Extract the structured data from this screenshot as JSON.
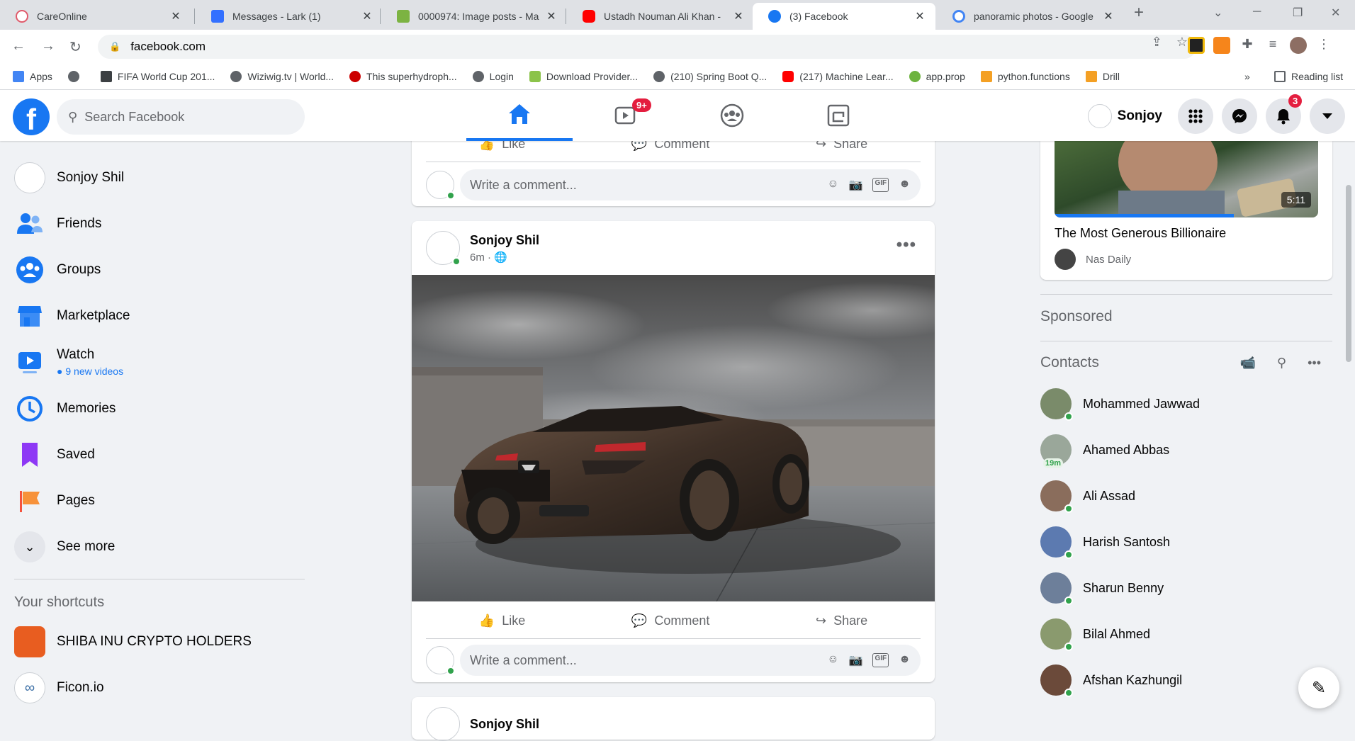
{
  "browser": {
    "tabs": [
      {
        "title": "CareOnline",
        "color": "#e05a6b"
      },
      {
        "title": "Messages - Lark (1)",
        "color": "#3370ff"
      },
      {
        "title": "0000974: Image posts - Ma",
        "color": "#7cb342"
      },
      {
        "title": "Ustadh Nouman Ali Khan -",
        "color": "#ff0000"
      },
      {
        "title": "(3) Facebook",
        "color": "#1877f2"
      },
      {
        "title": "panoramic photos - Google",
        "color": "#4285f4"
      }
    ],
    "new_tab": "+",
    "url": "facebook.com",
    "bookmarks": [
      {
        "label": "Apps",
        "color": "#4285f4"
      },
      {
        "label": "",
        "color": "#5f6368"
      },
      {
        "label": "FIFA World Cup 201...",
        "color": "#3c4043"
      },
      {
        "label": "Wiziwig.tv | World...",
        "color": "#5f6368"
      },
      {
        "label": "This superhydroph...",
        "color": "#cc0000"
      },
      {
        "label": "Login",
        "color": "#5f6368"
      },
      {
        "label": "Download Provider...",
        "color": "#8bc34a"
      },
      {
        "label": "(210) Spring Boot Q...",
        "color": "#5f6368"
      },
      {
        "label": "(217) Machine Lear...",
        "color": "#ff0000"
      },
      {
        "label": "app.prop",
        "color": "#6db33f"
      },
      {
        "label": "python.functions",
        "color": "#f4a024"
      },
      {
        "label": "Drill",
        "color": "#f4a024"
      }
    ],
    "bookmarks_more": "»",
    "reading_list": "Reading list"
  },
  "header": {
    "logo": "f",
    "search_placeholder": "Search Facebook",
    "watch_badge": "9+",
    "profile_name": "Sonjoy",
    "notifications_badge": "3"
  },
  "left_nav": {
    "profile": "Sonjoy Shil",
    "items": [
      {
        "label": "Friends",
        "color": "#1877f2"
      },
      {
        "label": "Groups",
        "color": "#1877f2"
      },
      {
        "label": "Marketplace",
        "color": "#1877f2"
      },
      {
        "label": "Watch",
        "sub": "9 new videos",
        "color": "#1877f2"
      },
      {
        "label": "Memories",
        "color": "#1877f2"
      },
      {
        "label": "Saved",
        "color": "#8e38f5"
      },
      {
        "label": "Pages",
        "color": "#f5533d"
      }
    ],
    "see_more": "See more",
    "shortcuts_title": "Your shortcuts",
    "shortcuts": [
      {
        "label": "SHIBA INU CRYPTO HOLDERS",
        "color": "#e85d20"
      },
      {
        "label": "Ficon.io",
        "color": "#3a6ea5"
      }
    ]
  },
  "feed": {
    "actions": {
      "like": "Like",
      "comment": "Comment",
      "share": "Share"
    },
    "comment_placeholder": "Write a comment...",
    "post": {
      "author": "Sonjoy Shil",
      "time": "6m ·"
    },
    "next_post_author": "Sonjoy Shil"
  },
  "right_col": {
    "video": {
      "duration": "5:11",
      "title": "The Most Generous Billionaire",
      "channel": "Nas Daily",
      "progress": 0.68
    },
    "sponsored": "Sponsored",
    "contacts_title": "Contacts",
    "contacts": [
      {
        "name": "Mohammed Jawwad",
        "color": "#7a8b6a",
        "status": "online"
      },
      {
        "name": "Ahamed Abbas",
        "color": "#9aa79a",
        "status": "19m"
      },
      {
        "name": "Ali Assad",
        "color": "#8a6d5c",
        "status": "online"
      },
      {
        "name": "Harish Santosh",
        "color": "#5c7ab0",
        "status": "online"
      },
      {
        "name": "Sharun Benny",
        "color": "#6d7f9a",
        "status": "online"
      },
      {
        "name": "Bilal Ahmed",
        "color": "#8a9a6e",
        "status": "online"
      },
      {
        "name": "Afshan Kazhungil",
        "color": "#6b4a3a",
        "status": "online"
      }
    ]
  }
}
